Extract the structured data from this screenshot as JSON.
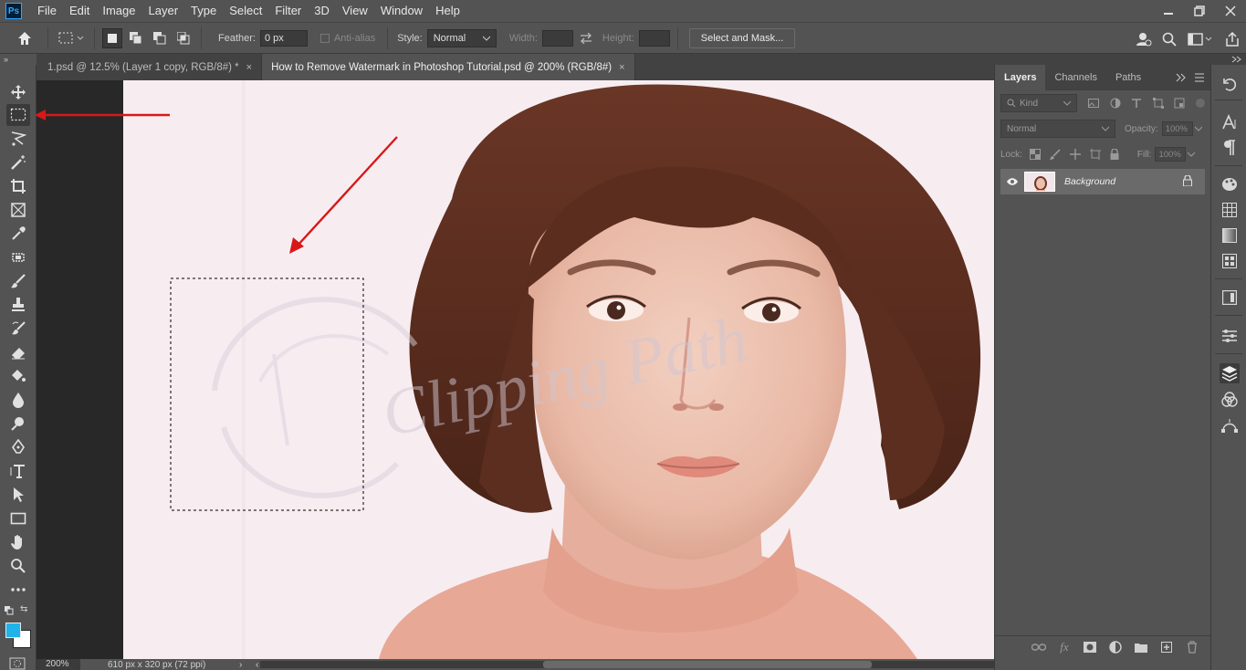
{
  "app": {
    "logo": "Ps"
  },
  "menu": [
    "File",
    "Edit",
    "Image",
    "Layer",
    "Type",
    "Select",
    "Filter",
    "3D",
    "View",
    "Window",
    "Help"
  ],
  "options": {
    "feather_label": "Feather:",
    "feather_value": "0 px",
    "antialias_label": "Anti-alias",
    "style_label": "Style:",
    "style_value": "Normal",
    "width_label": "Width:",
    "height_label": "Height:",
    "select_mask_label": "Select and Mask..."
  },
  "tabs": [
    {
      "label": "1.psd @ 12.5% (Layer 1 copy, RGB/8#) *",
      "close": "×",
      "active": false
    },
    {
      "label": "How to Remove Watermark in Photoshop Tutorial.psd @ 200% (RGB/8#)",
      "close": "×",
      "active": true
    }
  ],
  "status": {
    "zoom": "200%",
    "doc_info": "610 px x 320 px (72 ppi)",
    "arrow": "›",
    "left_arrow": "‹"
  },
  "layers_panel": {
    "tabs": [
      "Layers",
      "Channels",
      "Paths"
    ],
    "filter_placeholder": "Kind",
    "blend_mode": "Normal",
    "opacity_label": "Opacity:",
    "opacity_value": "100%",
    "lock_label": "Lock:",
    "fill_label": "Fill:",
    "fill_value": "100%",
    "layers": [
      {
        "name": "Background",
        "visible": true,
        "locked": true
      }
    ]
  },
  "colors": {
    "foreground": "#1fb3ea",
    "background": "#ffffff",
    "annotation": "#d81818"
  },
  "tools": [
    "move-tool",
    "marquee-tool",
    "lasso-tool",
    "magic-wand-tool",
    "crop-tool",
    "frame-tool",
    "eyedropper-tool",
    "healing-brush-tool",
    "brush-tool",
    "clone-stamp-tool",
    "history-brush-tool",
    "eraser-tool",
    "paint-bucket-tool",
    "blur-tool",
    "dodge-tool",
    "pen-tool",
    "type-tool",
    "path-selection-tool",
    "rectangle-tool",
    "hand-tool",
    "zoom-tool",
    "more-tools"
  ],
  "watermark": {
    "text": "Clipping Path"
  }
}
